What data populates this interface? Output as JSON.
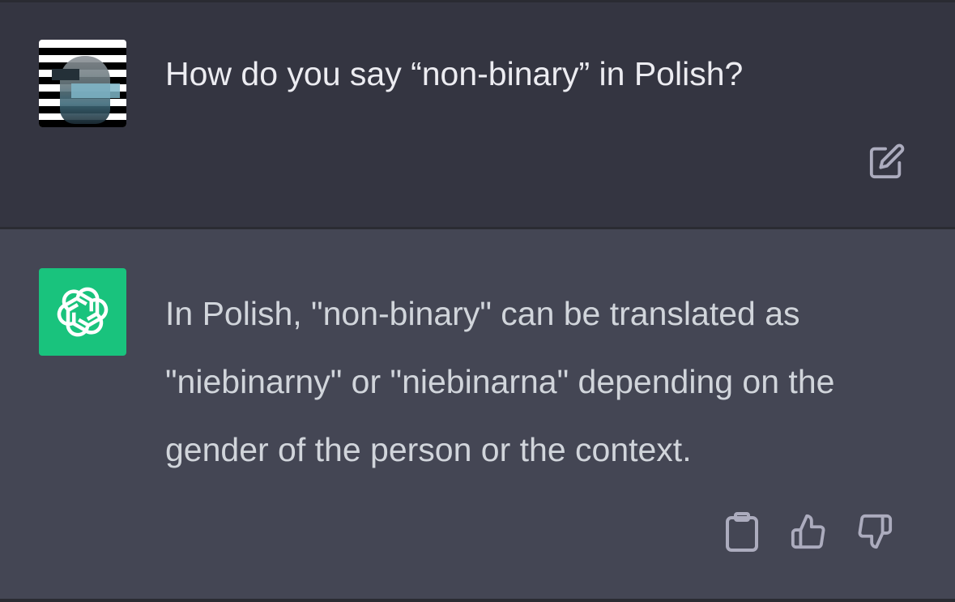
{
  "conversation": {
    "user_message": {
      "avatar": "user-photo-avatar",
      "text": "How do you say “non-binary” in Polish?",
      "edit_icon": "edit-icon"
    },
    "assistant_message": {
      "avatar": "openai-logo-icon",
      "text": "In Polish, \"non-binary\" can be translated as \"niebinarny\" or \"niebinarna\" depending on the gender of the person or the context.",
      "actions": [
        "copy-icon",
        "thumbs-up-icon",
        "thumbs-down-icon"
      ]
    }
  },
  "colors": {
    "user_bg": "#343541",
    "assistant_bg": "#444654",
    "bot_avatar": "#19c37d",
    "user_text": "#ececf1",
    "assistant_text": "#d1d5db",
    "icon": "#acacbe"
  }
}
